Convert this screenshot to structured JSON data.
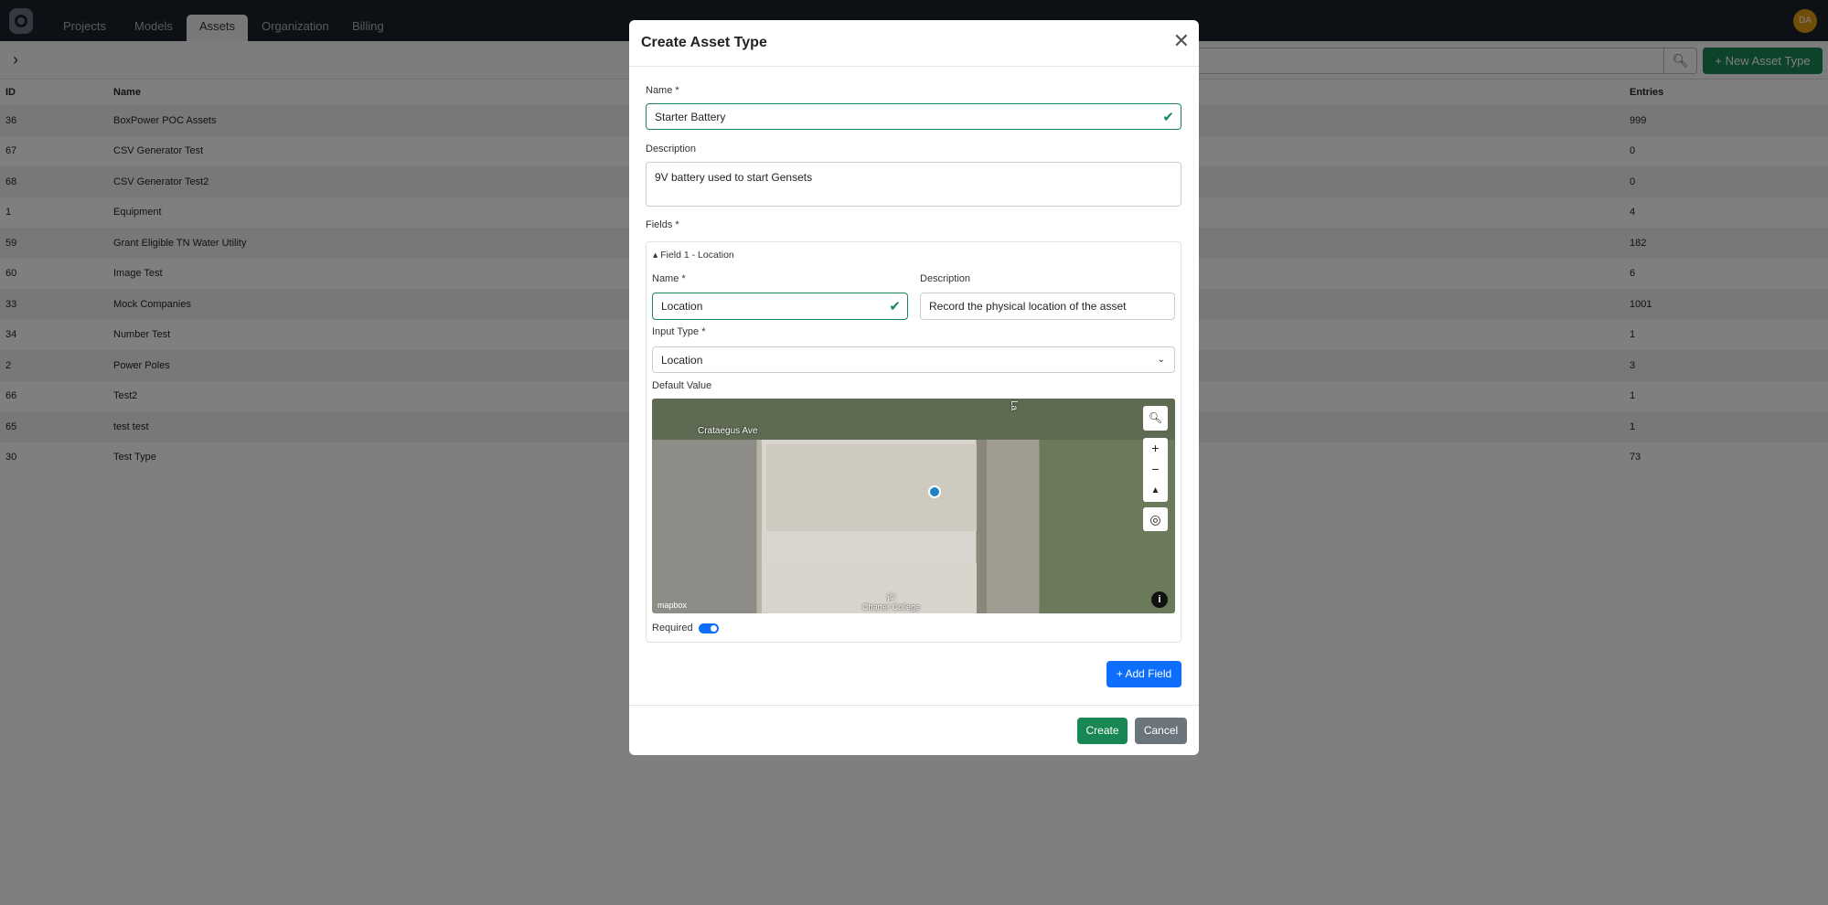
{
  "nav": {
    "tabs": [
      "Projects",
      "Models",
      "Assets",
      "Organization",
      "Billing"
    ],
    "active": "Assets",
    "avatar": "DA"
  },
  "toolbar": {
    "search_icon": "search-icon",
    "new_label": "+ New Asset Type"
  },
  "table": {
    "headers": [
      "ID",
      "Name",
      "Entries"
    ],
    "rows": [
      [
        "36",
        "BoxPower POC Assets",
        "999"
      ],
      [
        "67",
        "CSV Generator Test",
        "0"
      ],
      [
        "68",
        "CSV Generator Test2",
        "0"
      ],
      [
        "1",
        "Equipment",
        "4"
      ],
      [
        "59",
        "Grant Eligible TN Water Utility",
        "182"
      ],
      [
        "60",
        "Image Test",
        "6"
      ],
      [
        "33",
        "Mock Companies",
        "1001"
      ],
      [
        "34",
        "Number Test",
        "1"
      ],
      [
        "2",
        "Power Poles",
        "3"
      ],
      [
        "66",
        "Test2",
        "1"
      ],
      [
        "65",
        "test test",
        "1"
      ],
      [
        "30",
        "Test Type",
        "73"
      ]
    ]
  },
  "modal": {
    "title": "Create Asset Type",
    "name_label": "Name *",
    "name_value": "Starter Battery",
    "desc_label": "Description",
    "desc_value": "9V battery used to start Gensets",
    "fields_label": "Fields *",
    "field": {
      "header": "Field 1 - Location",
      "name_label": "Name *",
      "name_value": "Location",
      "desc_label": "Description",
      "desc_value": "Record the physical location of the asset",
      "type_label": "Input Type *",
      "type_value": "Location",
      "default_label": "Default Value",
      "required_label": "Required",
      "required": true,
      "map": {
        "street": "Crataegus Ave",
        "street2": "La",
        "poi": "Charter College",
        "attribution": "mapbox"
      }
    },
    "add_field": "+ Add Field",
    "create": "Create",
    "cancel": "Cancel"
  },
  "colors": {
    "primary": "#0d6efd",
    "success": "#198754",
    "nav": "#1b222b"
  }
}
